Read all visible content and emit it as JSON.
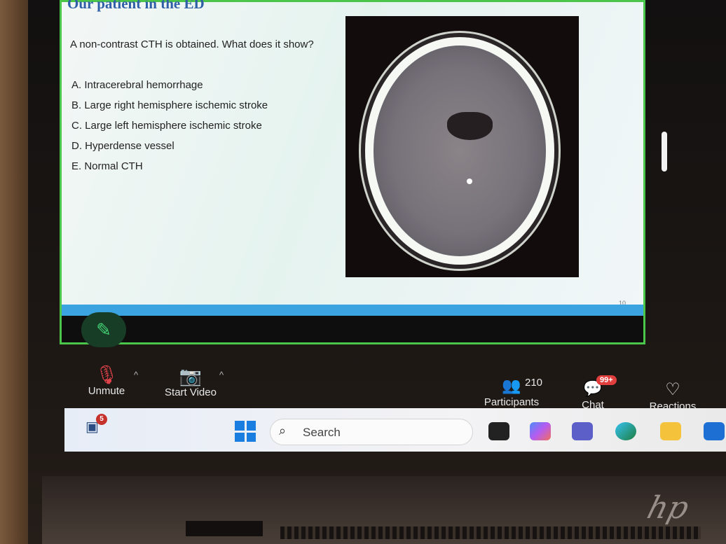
{
  "slide": {
    "title": "Our patient in the ED",
    "question": "A non-contrast CTH is obtained. What does it show?",
    "answers": [
      "A.  Intracerebral hemorrhage",
      "B.  Large right hemisphere ischemic stroke",
      "C.  Large left hemisphere ischemic stroke",
      "D.  Hyperdense vessel",
      "E.  Normal CTH"
    ],
    "page_number": "10"
  },
  "meeting": {
    "unmute_label": "Unmute",
    "start_video_label": "Start Video",
    "participants_count": "210",
    "participants_label": "Participants",
    "chat_badge": "99+",
    "chat_label": "Chat",
    "reactions_label": "Reactions"
  },
  "taskbar": {
    "widget_badge": "5",
    "search_placeholder": "Search"
  },
  "brand": {
    "logo_text": "hp"
  },
  "colors": {
    "slide_border": "#4cc64a",
    "title_blue": "#2f5fa7",
    "slide_bar": "#3ba4e0",
    "pen_green": "#43d274",
    "badge_red": "#e13e3e"
  }
}
